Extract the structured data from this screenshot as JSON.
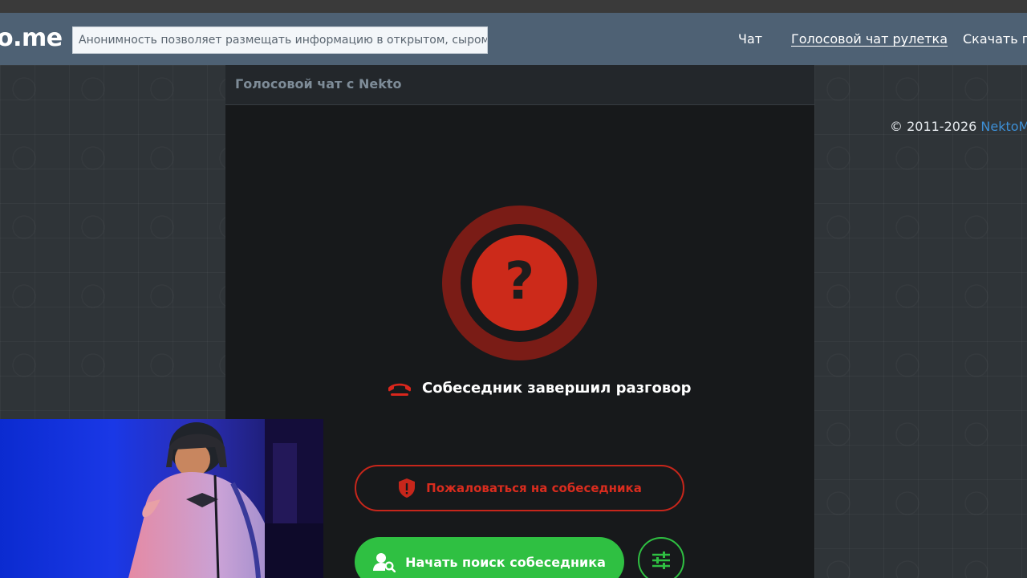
{
  "navbar": {
    "logo": "o.me",
    "slogan": "Анонимность позволяет размещать информацию в открытом, сыром виде!",
    "links": [
      {
        "label": "Чат",
        "active": false
      },
      {
        "label": "Голосовой чат рулетка",
        "active": true
      },
      {
        "label": "Скачать пр",
        "active": false
      }
    ]
  },
  "footer": {
    "copyright": "© 2011-2026",
    "brand": "NektoMe"
  },
  "panel": {
    "title": "Голосовой чат с Nekto",
    "status_icon": "question-mark",
    "status_symbol": "?",
    "status_text": "Собеседник завершил разговор",
    "report_button": "Пожаловаться на собеседника",
    "search_button": "Начать поиск собеседника"
  },
  "colors": {
    "navbar": "#4e6174",
    "danger": "#c7261b",
    "success": "#2fc042",
    "brand_link": "#3d8fd6"
  },
  "icons": [
    "hangup-phone-icon",
    "shield-alert-icon",
    "user-search-icon",
    "sliders-icon"
  ]
}
